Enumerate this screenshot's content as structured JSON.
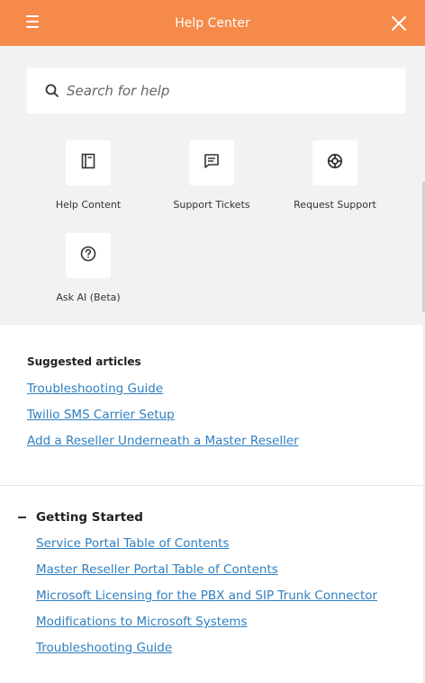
{
  "header": {
    "title": "Help Center",
    "bg_color": "#f58a4a"
  },
  "search": {
    "placeholder": "Search for help",
    "value": ""
  },
  "tiles": [
    {
      "label": "Help Content",
      "icon": "book-icon"
    },
    {
      "label": "Support Tickets",
      "icon": "chat-icon"
    },
    {
      "label": "Request Support",
      "icon": "lifebuoy-icon"
    },
    {
      "label": "Ask AI (Beta)",
      "icon": "question-circle-icon"
    }
  ],
  "suggested": {
    "title": "Suggested articles",
    "articles": [
      "Troubleshooting Guide",
      "Twilio SMS Carrier Setup",
      "Add a Reseller Underneath a Master Reseller"
    ]
  },
  "getting_started": {
    "title": "Getting Started",
    "articles": [
      "Service Portal Table of Contents",
      "Master Reseller Portal Table of Contents",
      "Microsoft Licensing for the PBX and SIP Trunk Connector",
      "Modifications to Microsoft Systems",
      "Troubleshooting Guide"
    ]
  },
  "colors": {
    "link": "#2f7fc1",
    "gray_bg": "#f2f2f2"
  }
}
